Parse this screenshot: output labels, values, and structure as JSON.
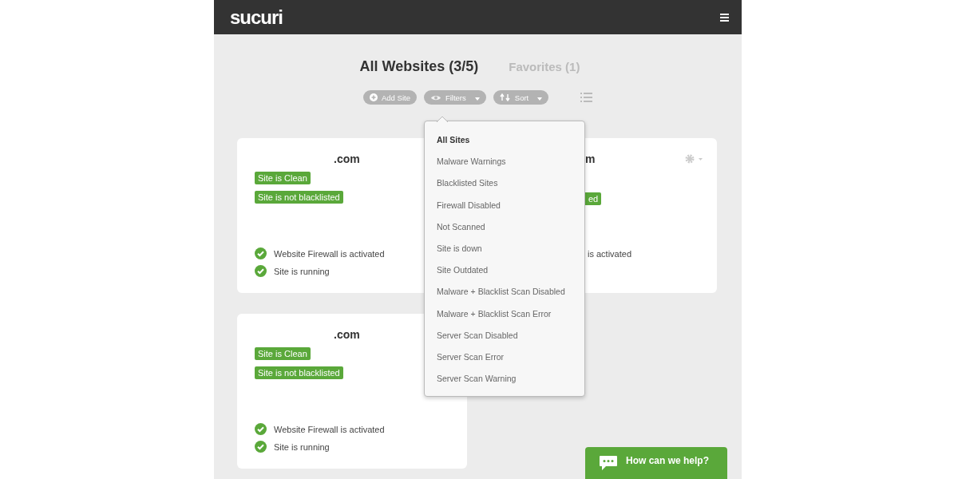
{
  "header": {
    "logo": "sucuri"
  },
  "tabs": [
    {
      "label": "All Websites (3/5)",
      "selected": true
    },
    {
      "label": "Favorites (1)",
      "selected": false
    }
  ],
  "toolbar": [
    {
      "kind": "add",
      "label": "Add Site"
    },
    {
      "kind": "filter",
      "label": "Filters"
    },
    {
      "kind": "sort",
      "label": "Sort"
    }
  ],
  "filter_menu": {
    "items": [
      {
        "label": "All Sites",
        "selected": true
      },
      {
        "label": "Malware Warnings",
        "selected": false
      },
      {
        "label": "Blacklisted Sites",
        "selected": false
      },
      {
        "label": "Firewall Disabled",
        "selected": false
      },
      {
        "label": "Not Scanned",
        "selected": false
      },
      {
        "label": "Site is down",
        "selected": false
      },
      {
        "label": "Site Outdated",
        "selected": false
      },
      {
        "label": "Malware + Blacklist Scan Disabled",
        "selected": false
      },
      {
        "label": "Malware + Blacklist Scan Error",
        "selected": false
      },
      {
        "label": "Server Scan Disabled",
        "selected": false
      },
      {
        "label": "Server Scan Error",
        "selected": false
      },
      {
        "label": "Server Scan Warning",
        "selected": false
      }
    ]
  },
  "sites": [
    {
      "kind": "full",
      "domain": ".com",
      "gear": false,
      "badges": [
        "Site is Clean",
        "Site is not blacklisted"
      ],
      "checks": [
        {
          "label": "Website Firewall is activated",
          "icon": true
        },
        {
          "label": "Site is running",
          "icon": true
        }
      ]
    },
    {
      "kind": "covered",
      "domain": "m",
      "gear": true,
      "badges": [
        "ed"
      ],
      "checks": [
        {
          "label": "is activated",
          "icon": false
        }
      ]
    },
    {
      "kind": "full",
      "domain": ".com",
      "gear": false,
      "badges": [
        "Site is Clean",
        "Site is not blacklisted"
      ],
      "checks": [
        {
          "label": "Website Firewall is activated",
          "icon": true
        },
        {
          "label": "Site is running",
          "icon": true
        }
      ]
    }
  ],
  "chat": {
    "label": "How can we help?"
  }
}
